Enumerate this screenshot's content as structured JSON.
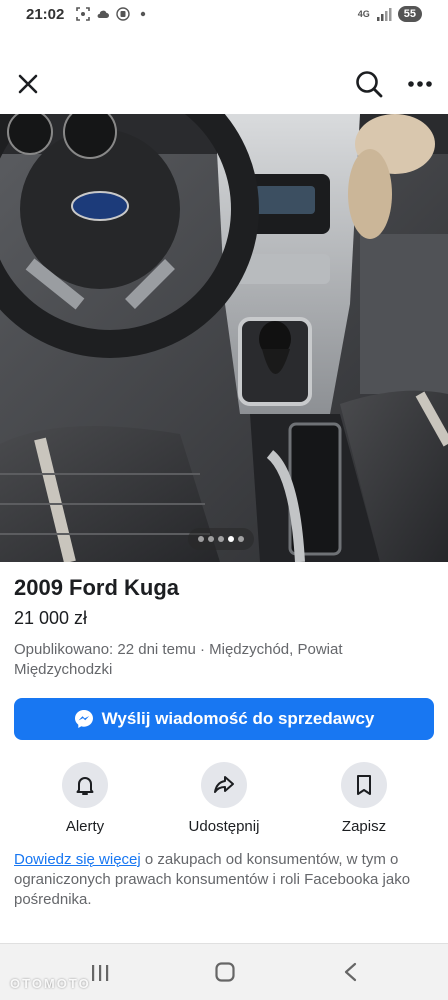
{
  "status_bar": {
    "time": "21:02",
    "network": "4G",
    "battery": "55",
    "icons": [
      "screenshot-icon",
      "cloud-icon",
      "nfc-icon",
      "dot-icon",
      "signal-icon"
    ]
  },
  "top_bar": {
    "close_icon": "close-icon",
    "search_icon": "search-icon",
    "more_icon": "more-icon"
  },
  "photo": {
    "dots_total": 5,
    "active_dot": 4
  },
  "listing": {
    "title": "2009 Ford Kuga",
    "price": "21 000 zł",
    "meta": "Opublikowano: 22 dni temu · Międzychód, Powiat Międzychodzki"
  },
  "message_button": {
    "label": "Wyślij wiadomość do sprzedawcy",
    "icon": "messenger-icon"
  },
  "actions": [
    {
      "label": "Alerty",
      "icon": "bell-icon"
    },
    {
      "label": "Udostępnij",
      "icon": "share-icon"
    },
    {
      "label": "Zapisz",
      "icon": "bookmark-icon"
    }
  ],
  "info": {
    "link": "Dowiedz się więcej",
    "text": " o zakupach od konsumentów, w tym o ograniczonych prawach konsumentów i roli Facebooka jako pośrednika."
  },
  "watermark": "OTOMOTO",
  "colors": {
    "accent": "#1877f2",
    "secondary_text": "#65676b",
    "action_circle": "#e4e6eb"
  }
}
